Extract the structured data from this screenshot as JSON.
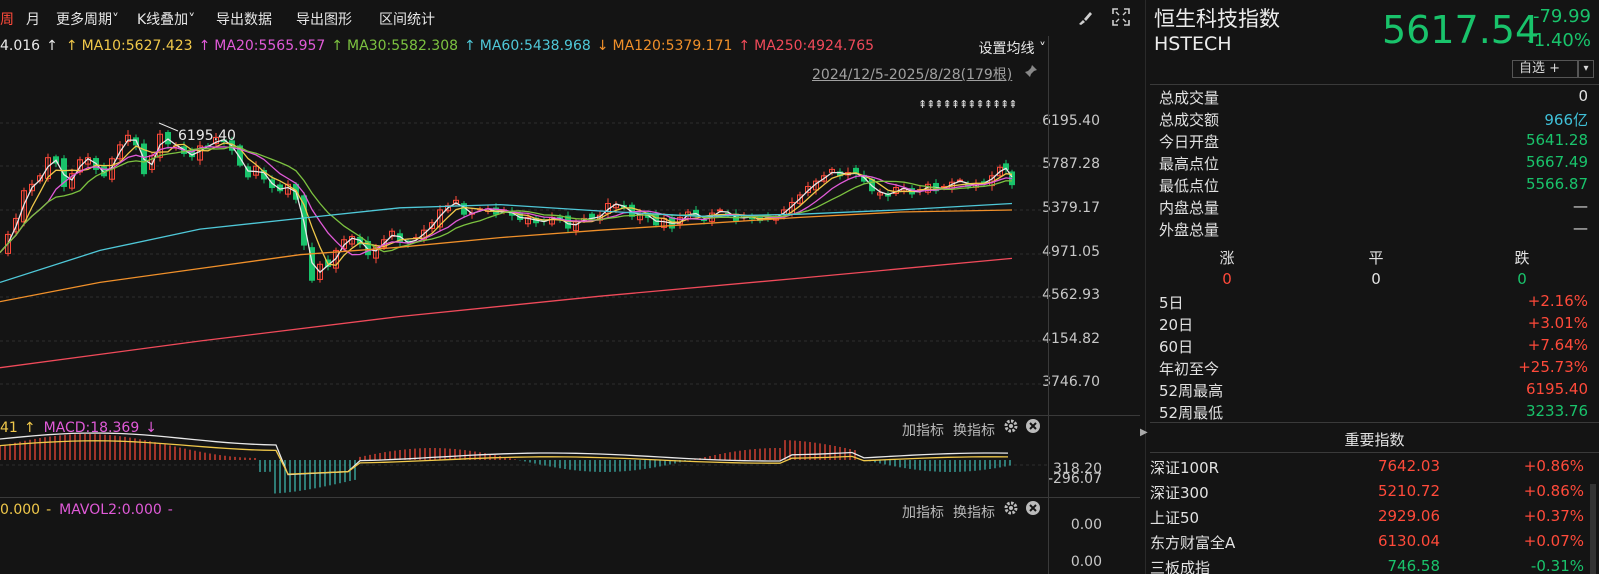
{
  "toolbar": {
    "items": [
      {
        "label": "周",
        "active": true
      },
      {
        "label": "月",
        "active": false
      },
      {
        "label": "更多周期",
        "active": false
      },
      {
        "label": "K线叠加",
        "active": false
      },
      {
        "label": "导出数据",
        "active": false
      },
      {
        "label": "导出图形",
        "active": false
      },
      {
        "label": "区间统计",
        "active": false
      }
    ],
    "chevron": "˅",
    "icons": [
      "brush-icon",
      "fullscreen-icon"
    ]
  },
  "ma_line": {
    "items": [
      {
        "text": "4.016",
        "arrow": "↑",
        "color": "#e8e8e8"
      },
      {
        "text": "MA10:5627.423",
        "arrow": "↑",
        "color": "#f0c84a"
      },
      {
        "text": "MA20:5565.957",
        "arrow": "↑",
        "color": "#e05ad8"
      },
      {
        "text": "MA30:5582.308",
        "arrow": "↑",
        "color": "#7cc240"
      },
      {
        "text": "MA60:5438.968",
        "arrow": "↑",
        "color": "#4fc8d8"
      },
      {
        "text": "MA120:5379.171",
        "arrow": "↓",
        "color": "#f0902a"
      },
      {
        "text": "MA250:4924.765",
        "arrow": "↑",
        "color": "#f04a5a"
      }
    ],
    "settings_label": "设置均线 ˅"
  },
  "range_label": "2024/12/5-2025/8/28(179根)",
  "main_chart": {
    "y_ticks": [
      "6195.40",
      "5787.28",
      "5379.17",
      "4971.05",
      "4562.93",
      "4154.82",
      "3746.70"
    ],
    "high_marker": "6195.40",
    "event_markers": "⇞⇞⇞⇞⇞⇞⇞⇞⇞⇞⇞⇞"
  },
  "macd_panel": {
    "head": [
      {
        "text": "41",
        "arrow": "↑",
        "color": "#f0c84a"
      },
      {
        "text": "MACD:18.369",
        "arrow": "↓",
        "color": "#e05ad8"
      }
    ],
    "y_ticks": [
      "318.20",
      "-296.07"
    ],
    "add_label": "加指标",
    "switch_label": "换指标"
  },
  "vol_panel": {
    "head": [
      {
        "text": "0.000",
        "arrow": "-",
        "color": "#f0c84a"
      },
      {
        "text": "MAVOL2:0.000",
        "arrow": "-",
        "color": "#e05ad8"
      }
    ],
    "y_ticks": [
      "0.00",
      "0.00"
    ],
    "add_label": "加指标",
    "switch_label": "换指标"
  },
  "quote": {
    "name": "恒生科技指数",
    "code": "HSTECH",
    "price": "5617.54",
    "change": "-79.99",
    "change_pct": "-1.40%",
    "watch_label": "自选 +",
    "watch_drop": "▾"
  },
  "stats": [
    {
      "label": "总成交量",
      "value": "0",
      "tone": "white"
    },
    {
      "label": "总成交额",
      "value": "966亿",
      "tone": "cyan"
    },
    {
      "label": "今日开盘",
      "value": "5641.28",
      "tone": "green"
    },
    {
      "label": "最高点位",
      "value": "5667.49",
      "tone": "green"
    },
    {
      "label": "最低点位",
      "value": "5566.87",
      "tone": "green"
    },
    {
      "label": "内盘总量",
      "value": "—",
      "tone": "white"
    },
    {
      "label": "外盘总量",
      "value": "—",
      "tone": "white"
    }
  ],
  "advance": {
    "up_label": "涨",
    "flat_label": "平",
    "down_label": "跌",
    "up": "0",
    "flat": "0",
    "down": "0"
  },
  "periods": [
    {
      "label": "5日",
      "value": "+2.16%",
      "tone": "red"
    },
    {
      "label": "20日",
      "value": "+3.01%",
      "tone": "red"
    },
    {
      "label": "60日",
      "value": "+7.64%",
      "tone": "red"
    },
    {
      "label": "年初至今",
      "value": "+25.73%",
      "tone": "red"
    },
    {
      "label": "52周最高",
      "value": "6195.40",
      "tone": "red"
    },
    {
      "label": "52周最低",
      "value": "3233.76",
      "tone": "green"
    }
  ],
  "important": {
    "title": "重要指数",
    "rows": [
      {
        "name": "深证100R",
        "price": "7642.03",
        "change": "+0.86%",
        "tone": "red"
      },
      {
        "name": "深证300",
        "price": "5210.72",
        "change": "+0.86%",
        "tone": "red"
      },
      {
        "name": "上证50",
        "price": "2929.06",
        "change": "+0.37%",
        "tone": "red"
      },
      {
        "name": "东方财富全A",
        "price": "6130.04",
        "change": "+0.07%",
        "tone": "red"
      },
      {
        "name": "三板成指",
        "price": "746.58",
        "change": "-0.31%",
        "tone": "green"
      }
    ]
  },
  "colors": {
    "bg": "#141414",
    "up": "#ff4a3a",
    "down": "#19c36b",
    "ma5": "#e8e8e8",
    "ma10": "#f0c84a",
    "ma20": "#e05ad8",
    "ma30": "#7cc240",
    "ma60": "#4fc8d8",
    "ma120": "#f0902a",
    "ma250": "#f04a5a"
  }
}
